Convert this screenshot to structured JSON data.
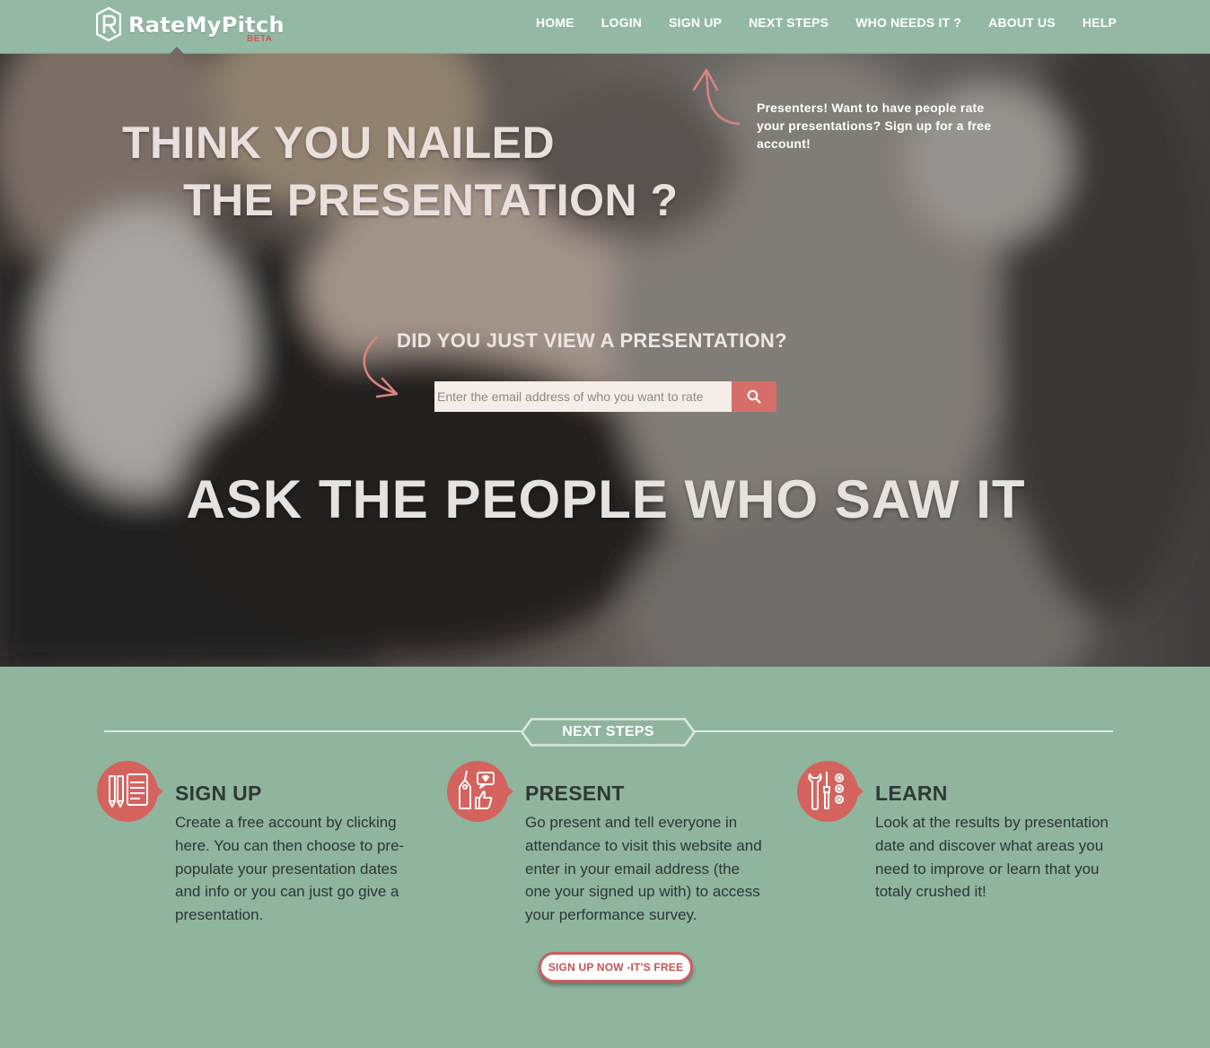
{
  "brand": {
    "name": "RateMyPitch",
    "badge": "BETA"
  },
  "nav": {
    "items": [
      {
        "label": "HOME"
      },
      {
        "label": "LOGIN"
      },
      {
        "label": "SIGN UP"
      },
      {
        "label": "NEXT STEPS"
      },
      {
        "label": "WHO NEEDS IT ?"
      },
      {
        "label": "ABOUT US"
      },
      {
        "label": "HELP"
      }
    ]
  },
  "hero": {
    "title_line1": "THINK YOU NAILED",
    "title_line2": "THE PRESENTATION ?",
    "presenter_note": "Presenters! Want to have people rate your presentations? Sign up for a free account!",
    "viewer_question": "DID YOU JUST VIEW A PRESENTATION?",
    "search_placeholder": "Enter the email address of who you want to rate",
    "tagline": "ASK THE PEOPLE WHO SAW IT"
  },
  "next_steps": {
    "heading": "NEXT STEPS",
    "steps": [
      {
        "title": "SIGN UP",
        "text": "Create a free account by clicking here. You can then choose to pre-populate your presentation dates and info or you can just go give a presentation.",
        "icon": "pencil-notepad-icon"
      },
      {
        "title": "PRESENT",
        "text": "Go present and tell everyone in attendance to visit this website and enter in your email address (the one your signed up with) to access your performance survey.",
        "icon": "tag-thumbs-up-icon"
      },
      {
        "title": "LEARN",
        "text": "Look at the results by presentation date and discover what areas you need to improve or learn that you totaly crushed it!",
        "icon": "tools-icon"
      }
    ],
    "cta_label": "SIGN UP NOW -IT'S FREE"
  },
  "colors": {
    "nav_bg": "#93b9a4",
    "section_bg": "#8fb59f",
    "accent": "#d66e6a",
    "brand_badge": "#c75a5a"
  }
}
